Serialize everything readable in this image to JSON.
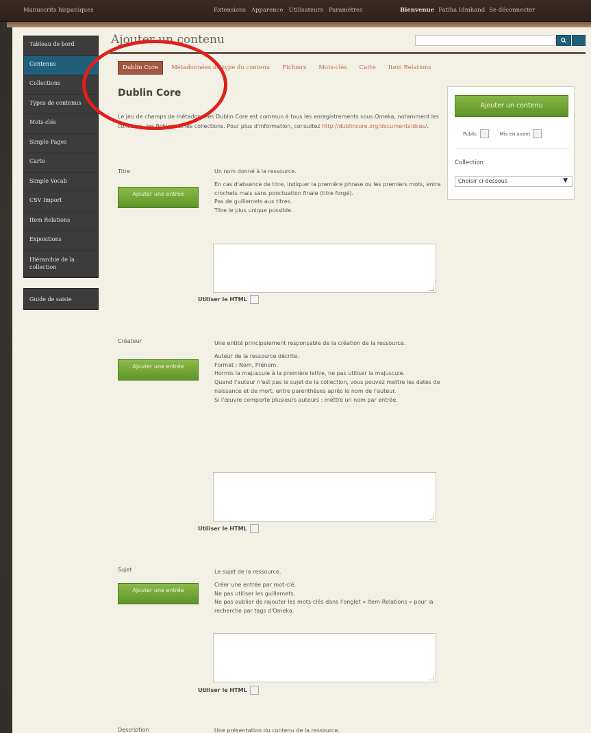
{
  "topbar": {
    "site_title": "Manuscrits hispaniques",
    "nav": [
      "Extensions",
      "Apparence",
      "Utilisateurs",
      "Paramètres"
    ],
    "welcome_label": "Bienvenue",
    "user_name": "Fatiha Idmhand",
    "logout": "Se déconnecter"
  },
  "sidebar": {
    "items": [
      {
        "label": "Tableau de bord",
        "active": false
      },
      {
        "label": "Contenus",
        "active": true
      },
      {
        "label": "Collections",
        "active": false
      },
      {
        "label": "Types de contenus",
        "active": false
      },
      {
        "label": "Mots-clés",
        "active": false
      },
      {
        "label": "Simple Pages",
        "active": false
      },
      {
        "label": "Carte",
        "active": false
      },
      {
        "label": "Simple Vocab",
        "active": false
      },
      {
        "label": "CSV Import",
        "active": false
      },
      {
        "label": "Item Relations",
        "active": false
      },
      {
        "label": "Expositions",
        "active": false
      },
      {
        "label": "Hiérarchie de la collection",
        "active": false
      }
    ],
    "guide": "Guide de saisie"
  },
  "header": {
    "title": "Ajouter un contenu",
    "search_value": "",
    "search_icon": "search-icon"
  },
  "tabs": [
    "Dublin Core",
    "Métadonnées du type du contenu",
    "Fichiers",
    "Mots-clés",
    "Carte",
    "Item Relations"
  ],
  "section": {
    "title": "Dublin Core",
    "intro": "Le jeu de champs de métadonnées Dublin Core est commun à tous les enregistrements sous Omeka, notamment les contenus, les fichiers et les collections. Pour plus d'information, consultez ",
    "intro_link": "http://dublincore.org/documents/dces/",
    "intro_end": "."
  },
  "panel": {
    "add_button": "Ajouter un contenu",
    "public_label": "Public",
    "featured_label": "Mis en avant",
    "collection_label": "Collection",
    "collection_value": "Choisir ci-dessous"
  },
  "fields": {
    "add_entry_label": "Ajouter une entrée",
    "use_html_label": "Utiliser le HTML",
    "titre": {
      "label": "Titre",
      "desc": [
        "Un nom donné à la ressource.",
        "En cas d'absence de titre, indiquer la première phrase ou les premiers mots, entre crochets mais sans ponctuation finale (titre forgé).",
        "Pas de guillemets aux titres.",
        "Titre le plus unique possible."
      ]
    },
    "createur": {
      "label": "Créateur",
      "desc": [
        "Une entité principalement responsable de la création de la ressource.",
        "Auteur de la ressource décrite.",
        "Format : Nom, Prénom.",
        "Hormis la majuscule à la première lettre, ne pas utiliser la majuscule.",
        "Quand l'auteur n'est pas le sujet de la collection, vous pouvez mettre les dates de naissance et de mort, entre parenthèses après le nom de l'auteur.",
        "Si l'œuvre comporte plusieurs auteurs : mettre un nom par entrée."
      ]
    },
    "sujet": {
      "label": "Sujet",
      "desc": [
        "Le sujet de la ressource.",
        "Créer une entrée par mot-clé.",
        "Ne pas utiliser les guillemets.",
        "Ne pas oublier de rajouter les mots-clés dans l'onglet « Item-Relations » pour la recherche par tags d'Omeka."
      ]
    },
    "description": {
      "label": "Description",
      "desc": [
        "Une présentation du contenu de la ressource."
      ]
    }
  },
  "colors": {
    "accent_blue": "#1f5f7a",
    "tab_active": "#a4573f",
    "green_button": "#6ea334",
    "annotation_red": "#e0201a"
  }
}
